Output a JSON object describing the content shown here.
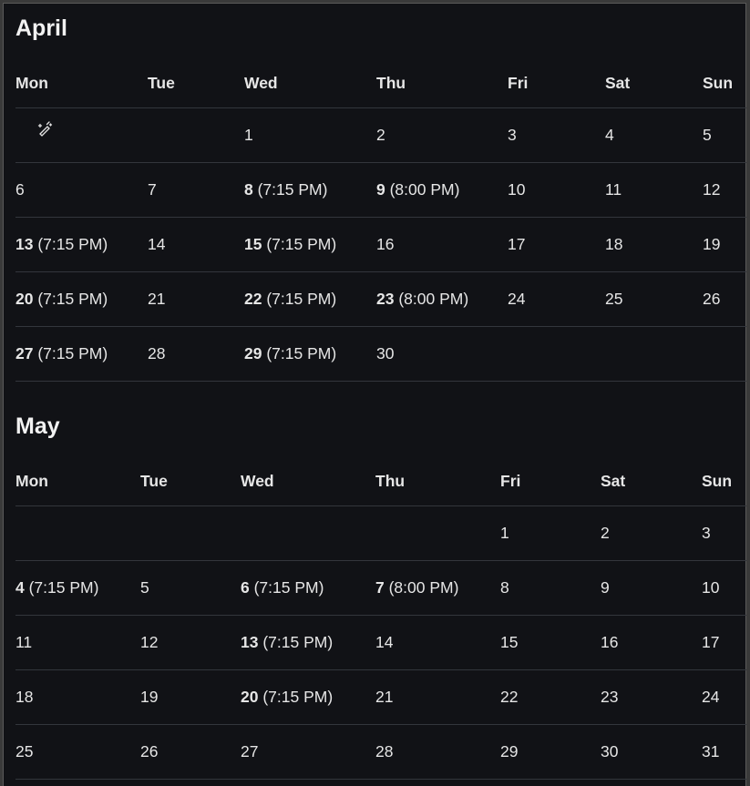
{
  "months": [
    {
      "title": "April",
      "weekdays": [
        "Mon",
        "Tue",
        "Wed",
        "Thu",
        "Fri",
        "Sat",
        "Sun"
      ],
      "weeks": [
        [
          null,
          null,
          {
            "day": "1"
          },
          {
            "day": "2"
          },
          {
            "day": "3"
          },
          {
            "day": "4"
          },
          {
            "day": "5"
          }
        ],
        [
          {
            "day": "6"
          },
          {
            "day": "7"
          },
          {
            "day": "8",
            "time": "(7:15 PM)"
          },
          {
            "day": "9",
            "time": "(8:00 PM)"
          },
          {
            "day": "10"
          },
          {
            "day": "11"
          },
          {
            "day": "12"
          }
        ],
        [
          {
            "day": "13",
            "time": "(7:15 PM)"
          },
          {
            "day": "14"
          },
          {
            "day": "15",
            "time": "(7:15 PM)"
          },
          {
            "day": "16"
          },
          {
            "day": "17"
          },
          {
            "day": "18"
          },
          {
            "day": "19"
          }
        ],
        [
          {
            "day": "20",
            "time": "(7:15 PM)"
          },
          {
            "day": "21"
          },
          {
            "day": "22",
            "time": "(7:15 PM)"
          },
          {
            "day": "23",
            "time": "(8:00 PM)"
          },
          {
            "day": "24"
          },
          {
            "day": "25"
          },
          {
            "day": "26"
          }
        ],
        [
          {
            "day": "27",
            "time": "(7:15 PM)"
          },
          {
            "day": "28"
          },
          {
            "day": "29",
            "time": "(7:15 PM)"
          },
          {
            "day": "30"
          },
          null,
          null,
          null
        ]
      ]
    },
    {
      "title": "May",
      "weekdays": [
        "Mon",
        "Tue",
        "Wed",
        "Thu",
        "Fri",
        "Sat",
        "Sun"
      ],
      "weeks": [
        [
          null,
          null,
          null,
          null,
          {
            "day": "1"
          },
          {
            "day": "2"
          },
          {
            "day": "3"
          }
        ],
        [
          {
            "day": "4",
            "time": "(7:15 PM)"
          },
          {
            "day": "5"
          },
          {
            "day": "6",
            "time": "(7:15 PM)"
          },
          {
            "day": "7",
            "time": "(8:00 PM)"
          },
          {
            "day": "8"
          },
          {
            "day": "9"
          },
          {
            "day": "10"
          }
        ],
        [
          {
            "day": "11"
          },
          {
            "day": "12"
          },
          {
            "day": "13",
            "time": "(7:15 PM)"
          },
          {
            "day": "14"
          },
          {
            "day": "15"
          },
          {
            "day": "16"
          },
          {
            "day": "17"
          }
        ],
        [
          {
            "day": "18"
          },
          {
            "day": "19"
          },
          {
            "day": "20",
            "time": "(7:15 PM)"
          },
          {
            "day": "21"
          },
          {
            "day": "22"
          },
          {
            "day": "23"
          },
          {
            "day": "24"
          }
        ],
        [
          {
            "day": "25"
          },
          {
            "day": "26"
          },
          {
            "day": "27"
          },
          {
            "day": "28"
          },
          {
            "day": "29"
          },
          {
            "day": "30"
          },
          {
            "day": "31"
          }
        ]
      ]
    }
  ],
  "icons": {
    "first_cell_icon": "magic-wand-icon"
  },
  "colors": {
    "background": "#111216",
    "text": "#e6e6e6",
    "row_divider": "#33363c"
  }
}
